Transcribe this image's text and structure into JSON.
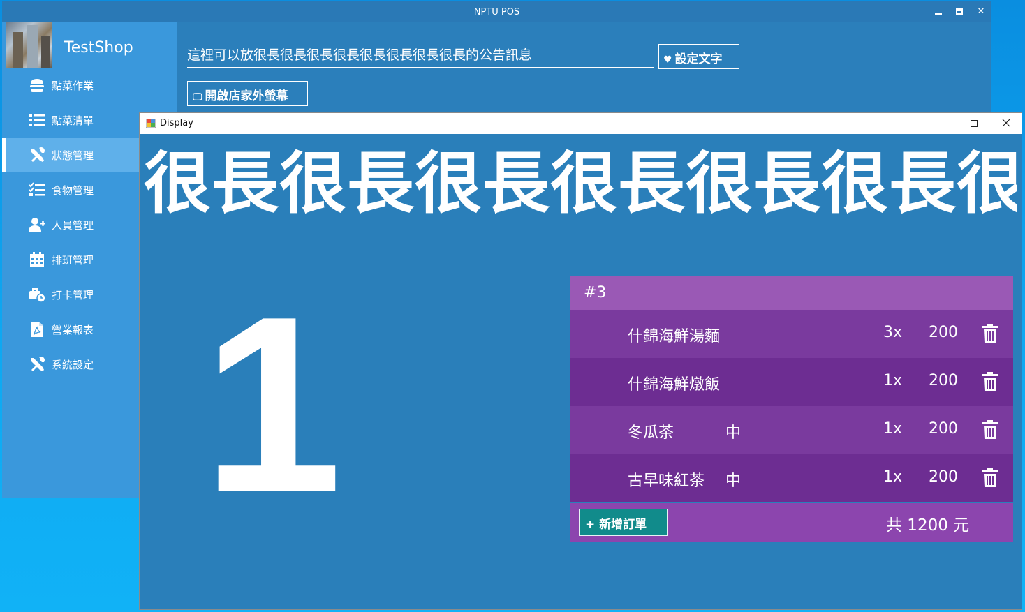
{
  "main_window": {
    "title": "NPTU POS",
    "controls": {
      "minimize": "minimize-icon",
      "maximize": "maximize-icon",
      "close": "✕"
    }
  },
  "shop": {
    "name": "TestShop"
  },
  "sidebar": {
    "items": [
      {
        "label": "點菜作業",
        "icon": "hamburger-icon"
      },
      {
        "label": "點菜清單",
        "icon": "list-icon"
      },
      {
        "label": "狀態管理",
        "icon": "tools-icon",
        "active": true
      },
      {
        "label": "食物管理",
        "icon": "tasks-icon"
      },
      {
        "label": "人員管理",
        "icon": "user-plus-icon"
      },
      {
        "label": "排班管理",
        "icon": "calendar-icon"
      },
      {
        "label": "打卡管理",
        "icon": "toolbox-clock-icon"
      },
      {
        "label": "營業報表",
        "icon": "pdf-file-icon"
      },
      {
        "label": "系統設定",
        "icon": "tools-icon"
      }
    ]
  },
  "announcement": {
    "value": "這裡可以放很長很長很長很長很長很長很長很長的公告訊息",
    "set_text_label": "設定文字",
    "set_text_icon": "♥",
    "open_display_label": "開啟店家外螢幕",
    "open_display_icon": "🖵"
  },
  "display_window": {
    "title": "Display",
    "marquee": "很長很長很長很長很長很長很長",
    "current_number": "1",
    "order": {
      "header": "#3",
      "items": [
        {
          "name": "什錦海鮮湯麵",
          "size": "",
          "qty": "3x",
          "price": "200"
        },
        {
          "name": "什錦海鮮燉飯",
          "size": "",
          "qty": "1x",
          "price": "200"
        },
        {
          "name": "冬瓜茶",
          "size": "中",
          "qty": "1x",
          "price": "200"
        },
        {
          "name": "古早味紅茶",
          "size": "中",
          "qty": "1x",
          "price": "200"
        }
      ],
      "add_order_label": "+ 新增訂單",
      "total": "共 1200 元"
    }
  },
  "colors": {
    "main_bg": "#2b7fbb",
    "sidebar_bg": "#3a98dc",
    "sidebar_active": "#5fb0ea",
    "order_header": "#9a59b5",
    "order_row_a": "#7a3a9e",
    "order_row_b": "#6d2d92",
    "order_footer": "#8c45ae",
    "add_button": "#118b8b"
  }
}
